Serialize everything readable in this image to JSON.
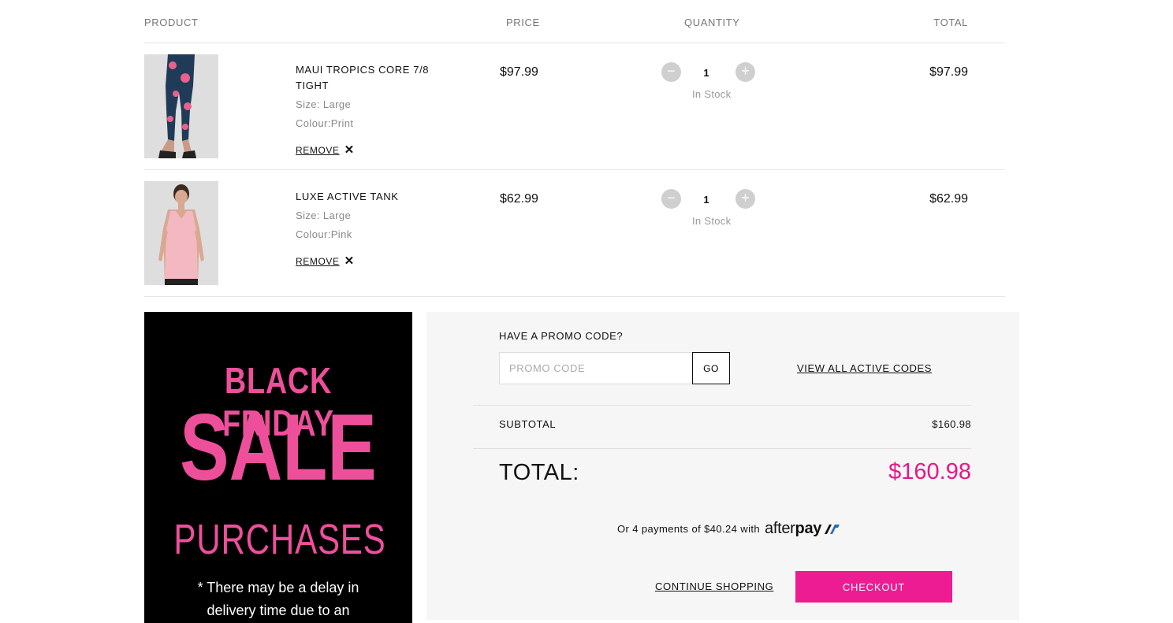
{
  "headers": {
    "product": "PRODUCT",
    "price": "PRICE",
    "quantity": "QUANTITY",
    "total": "TOTAL"
  },
  "items": [
    {
      "name": "MAUI TROPICS CORE 7/8 TIGHT",
      "size": "Size: Large",
      "colour": "Colour:Print",
      "remove": "REMOVE",
      "price": "$97.99",
      "qty": "1",
      "stock": "In Stock",
      "total": "$97.99"
    },
    {
      "name": "LUXE ACTIVE TANK",
      "size": "Size: Large",
      "colour": "Colour:Pink",
      "remove": "REMOVE",
      "price": "$62.99",
      "qty": "1",
      "stock": "In Stock",
      "total": "$62.99"
    }
  ],
  "banner": {
    "line1": "BLACK FRIDAY",
    "line2": "SALE",
    "line3": "PURCHASES",
    "line4a": "* There may be a delay in",
    "line4b": "delivery time due to an"
  },
  "summary": {
    "promo_label": "HAVE A PROMO CODE?",
    "promo_placeholder": "PROMO CODE",
    "go": "GO",
    "view_codes": "VIEW ALL ACTIVE CODES",
    "subtotal_label": "SUBTOTAL",
    "subtotal_value": "$160.98",
    "total_label": "TOTAL:",
    "total_value": "$160.98",
    "afterpay_text": "Or 4 payments of $40.24 with",
    "afterpay_brand_a": "after",
    "afterpay_brand_b": "pay",
    "continue": "CONTINUE SHOPPING",
    "checkout": "CHECKOUT"
  },
  "colors": {
    "accent": "#ee1c92",
    "total": "#e6168a",
    "banner_pink": "#ee4f9b"
  }
}
